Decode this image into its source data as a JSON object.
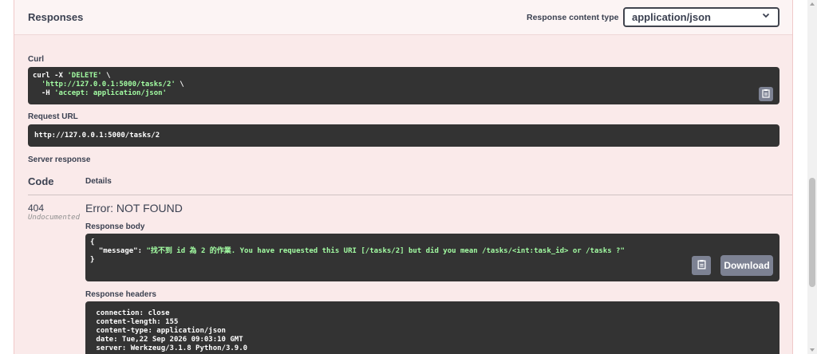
{
  "responses": {
    "title": "Responses",
    "content_type_label": "Response content type",
    "content_type_value": "application/json"
  },
  "curl": {
    "label": "Curl",
    "line1_cmd": "curl -X ",
    "line1_method": "'DELETE'",
    "line1_end": " \\",
    "line2_url": "  'http://127.0.0.1:5000/tasks/2'",
    "line2_end": " \\",
    "line3_flag": "  -H ",
    "line3_header": "'accept: application/json'"
  },
  "request_url": {
    "label": "Request URL",
    "value": "http://127.0.0.1:5000/tasks/2"
  },
  "server_response": {
    "label": "Server response",
    "code_header": "Code",
    "details_header": "Details",
    "status_code": "404",
    "undocumented": "Undocumented",
    "error_title": "Error: NOT FOUND",
    "body_label": "Response body",
    "body_open": "{",
    "body_key": "  \"message\": ",
    "body_value": "\"找不到 id 為 2 的作業. You have requested this URI [/tasks/2] but did you mean /tasks/<int:task_id> or /tasks ?\"",
    "body_close": "}",
    "download_label": "Download",
    "headers_label": "Response headers",
    "headers": [
      " connection: close",
      " content-length: 155",
      " content-type: application/json",
      " date: Tue,22 Sep 2026 09:03:10 GMT",
      " server: Werkzeug/3.1.8 Python/3.9.0"
    ]
  },
  "icons": {
    "copy": "clipboard-icon",
    "dropdown": "chevron-down-icon"
  }
}
